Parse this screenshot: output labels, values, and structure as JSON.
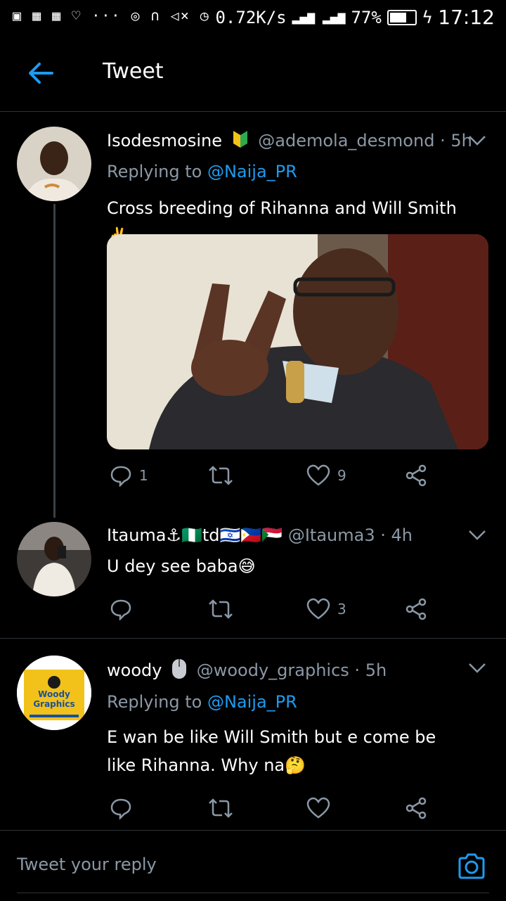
{
  "status_bar": {
    "network_speed": "0.72K/s",
    "battery": "77%",
    "battery_level": 0.77,
    "time": "17:12"
  },
  "header": {
    "title": "Tweet"
  },
  "tweets": [
    {
      "name": "Isodesmosine",
      "handle": "@ademola_desmond",
      "time": "5h",
      "replying_label": "Replying to",
      "replying_to": "@Naija_PR",
      "text": "Cross breeding of Rihanna and Will Smith ✌️",
      "replies": "1",
      "retweets": "",
      "likes": "9"
    },
    {
      "name": "Itauma⚓🇳🇬td🇮🇱🇵🇭🇸🇩",
      "handle": "@Itauma3",
      "time": "4h",
      "text": "U dey see baba😅",
      "replies": "",
      "retweets": "",
      "likes": "3"
    },
    {
      "name": "woody",
      "handle": "@woody_graphics",
      "time": "5h",
      "replying_label": "Replying to",
      "replying_to": "@Naija_PR",
      "text": "E wan be like Will Smith but e come be like Rihanna. Why na🤔",
      "avatar_text_1": "Woody",
      "avatar_text_2": "Graphics",
      "replies": "",
      "retweets": "",
      "likes": ""
    }
  ],
  "composer": {
    "placeholder": "Tweet your reply"
  },
  "colors": {
    "accent": "#1d9bf0",
    "muted": "#8b98a5",
    "background": "#000000"
  }
}
